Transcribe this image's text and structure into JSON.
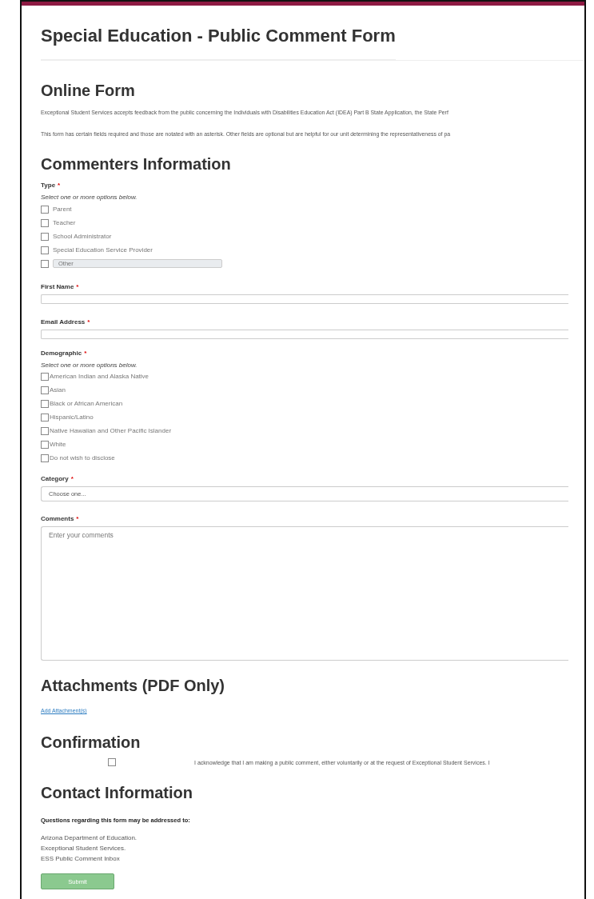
{
  "title": "Special Education - Public Comment Form",
  "online_form": {
    "heading": "Online Form",
    "paragraphs": [
      "Exceptional Student Services accepts feedback from the public concerning the Individuals with Disabilities Education Act (IDEA) Part B State Application, the State Perf",
      "This form has certain fields required and those are notated with an asterisk. Other fields are optional but are helpful for our unit determining the representativeness of pa"
    ]
  },
  "commenters": {
    "heading": "Commenters Information",
    "type": {
      "label": "Type",
      "required_mark": "*",
      "hint": "Select one or more options below.",
      "options": [
        {
          "label": "Parent",
          "checked": false
        },
        {
          "label": "Teacher",
          "checked": false
        },
        {
          "label": "School Administrator",
          "checked": false
        },
        {
          "label": "Special Education Service Provider",
          "checked": false
        },
        {
          "kind": "other",
          "placeholder": "Other",
          "checked": false
        }
      ]
    },
    "first_name": {
      "label": "First Name",
      "required_mark": "*"
    },
    "email": {
      "label": "Email Address",
      "required_mark": "*"
    },
    "demographic": {
      "label": "Demographic",
      "required_mark": "*",
      "hint": "Select one or more options below.",
      "options": [
        {
          "label": "American Indian and Alaska Native",
          "checked": false
        },
        {
          "label": "Asian",
          "checked": false
        },
        {
          "label": "Black or African American",
          "checked": false
        },
        {
          "label": "Hispanic/Latino",
          "checked": false
        },
        {
          "label": "Native Hawaiian and Other Pacific Islander",
          "checked": false
        },
        {
          "label": "White",
          "checked": false
        },
        {
          "label": "Do not wish to disclose",
          "checked": false
        }
      ]
    },
    "category": {
      "label": "Category",
      "required_mark": "*",
      "value": "Choose one..."
    },
    "comments": {
      "label": "Comments",
      "required_mark": "*",
      "placeholder": "Enter your comments"
    }
  },
  "attachments": {
    "heading": "Attachments (PDF Only)",
    "link": "Add Attachment(s)"
  },
  "confirmation": {
    "heading": "Confirmation",
    "checked": false,
    "text": "I acknowledge that I am making a public comment, either voluntarily or at the request of Exceptional Student Services. I"
  },
  "contact": {
    "heading": "Contact Information",
    "intro": "Questions regarding this form may be addressed to:",
    "lines": [
      "Arizona Department of Education.",
      "Exceptional Student Services."
    ],
    "link": "ESS Public Comment Inbox"
  },
  "submit": {
    "label": "Submit",
    "disabled": true
  }
}
